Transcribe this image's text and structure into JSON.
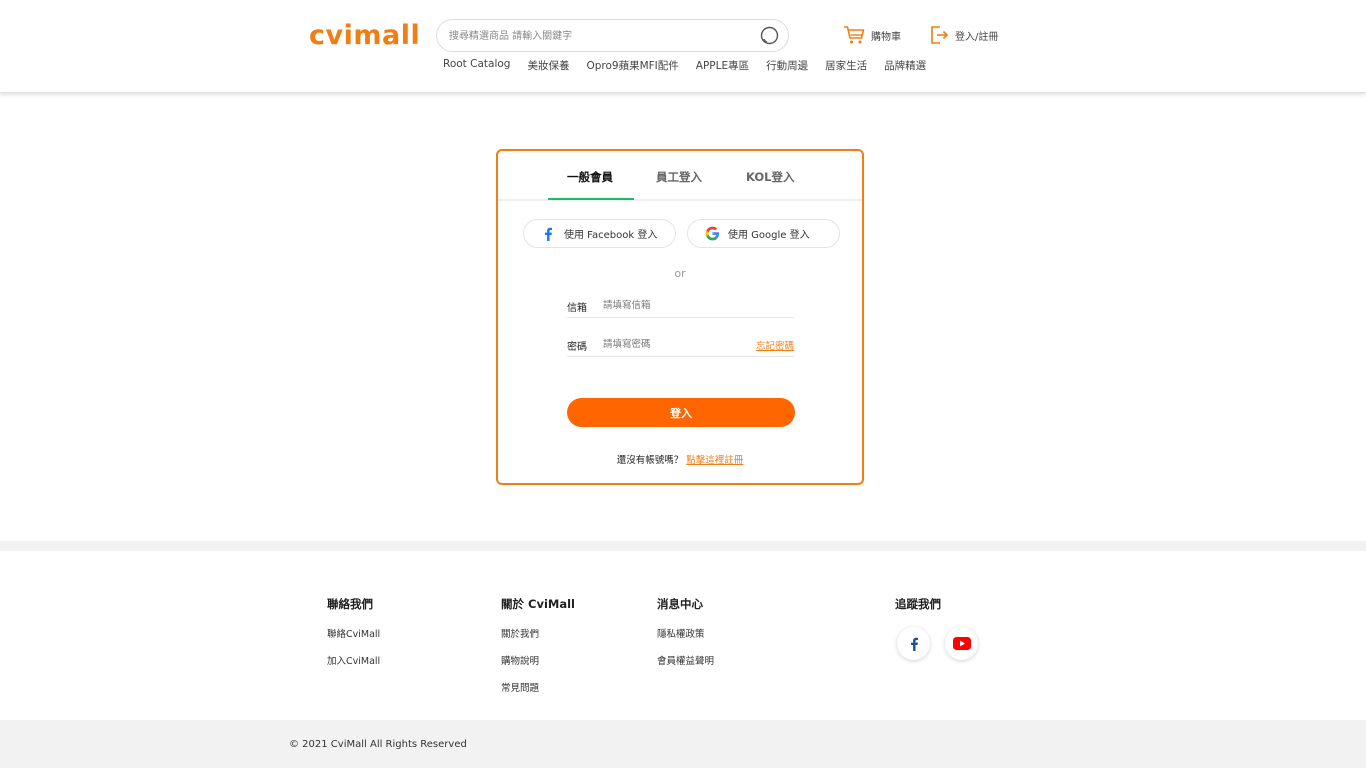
{
  "header": {
    "logo": "cvimall",
    "search_placeholder": "搜尋精選商品 請輸入關鍵字",
    "cart_label": "購物車",
    "login_label": "登入/註冊",
    "nav": [
      "Root Catalog",
      "美妝保養",
      "Opro9蘋果MFI配件",
      "APPLE專區",
      "行動周邊",
      "居家生活",
      "品牌精選"
    ]
  },
  "login": {
    "tabs": [
      "一般會員",
      "員工登入",
      "KOL登入"
    ],
    "active_tab": 0,
    "facebook_label": "使用 Facebook 登入",
    "google_label": "使用 Google 登入",
    "or": "or",
    "email_label": "信箱",
    "email_placeholder": "請填寫信箱",
    "password_label": "密碼",
    "password_placeholder": "請填寫密碼",
    "forgot_label": "忘記密碼",
    "submit_label": "登入",
    "no_account_text": "還沒有帳號嗎？",
    "register_link": "點擊這裡註冊"
  },
  "footer": {
    "contact": {
      "title": "聯絡我們",
      "items": [
        "聯絡CviMall",
        "加入CviMall"
      ]
    },
    "about": {
      "title": "關於 CviMall",
      "items": [
        "關於我們",
        "購物說明",
        "常見問題"
      ]
    },
    "news": {
      "title": "消息中心",
      "items": [
        "隱私權政策",
        "會員權益聲明"
      ]
    },
    "follow": {
      "title": "追蹤我們"
    },
    "copyright": "© 2021 CviMall All Rights Reserved"
  },
  "colors": {
    "brand": "#f07e14",
    "button": "#ff6600",
    "tab_underline": "#1fba6b",
    "facebook": "#1877f2",
    "youtube": "#ff0000"
  },
  "icons": [
    "search-icon",
    "cart-icon",
    "login-exit-icon",
    "facebook-icon",
    "google-icon",
    "youtube-icon"
  ]
}
